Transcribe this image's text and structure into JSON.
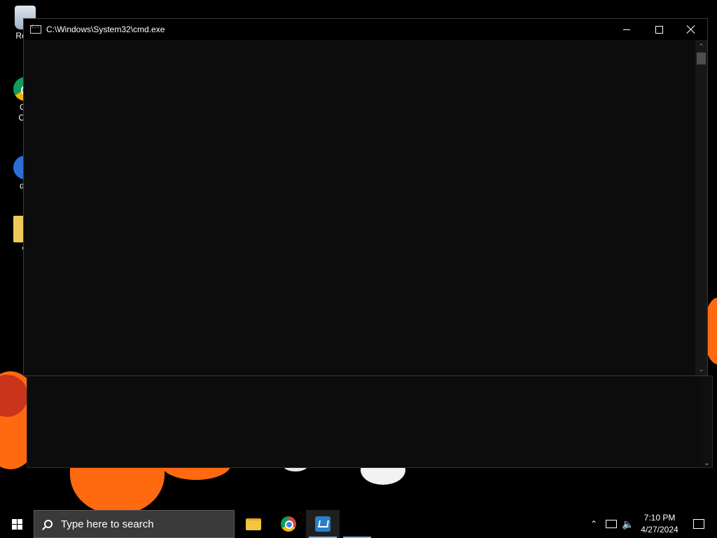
{
  "desktop": {
    "icons": [
      {
        "label": "Recycle Bin",
        "visible_label": "Recy"
      },
      {
        "label": "Google Chrome",
        "visible_label_line1": "Go",
        "visible_label_line2": "Chr"
      },
      {
        "label": "dinosaur",
        "visible_label": "din"
      },
      {
        "label": "folder",
        "visible_label": "w"
      }
    ]
  },
  "cmd_window": {
    "title": "C:\\Windows\\System32\\cmd.exe",
    "minimize_label": "Minimize",
    "maximize_label": "Maximize",
    "close_label": "Close",
    "content": ""
  },
  "taskbar": {
    "search_placeholder": "Type here to search",
    "apps": [
      "File Explorer",
      "Google Chrome",
      "Active App"
    ],
    "tray": {
      "time": "7:10 PM",
      "date": "4/27/2024"
    }
  }
}
